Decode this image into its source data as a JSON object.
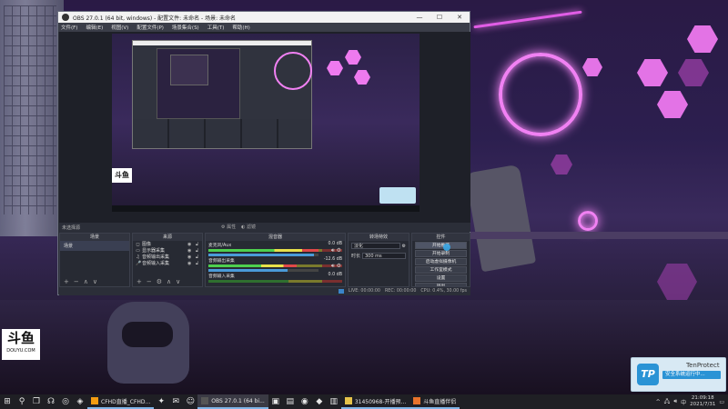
{
  "obs": {
    "title": "OBS 27.0.1 (64 bit, windows) - 配置文件: 未命名 - 场景: 未命名",
    "menu": [
      "文件(F)",
      "编辑(E)",
      "视图(V)",
      "配置文件(P)",
      "场景集合(S)",
      "工具(T)",
      "帮助(H)"
    ],
    "window_controls": {
      "minimize": "—",
      "maximize": "☐",
      "close": "✕"
    },
    "preview_toolbar": {
      "label": "未选择源",
      "properties": "属性",
      "filters": "滤镜"
    },
    "preview_watermark": "斗鱼",
    "docks": {
      "scenes": {
        "title": "场景",
        "items": [
          "场景"
        ]
      },
      "sources": {
        "title": "来源",
        "items": [
          {
            "icon": "◻",
            "name": "图像"
          },
          {
            "icon": "▭",
            "name": "显示器采集"
          },
          {
            "icon": "♫",
            "name": "音频输出采集"
          },
          {
            "icon": "🎤",
            "name": "音频输入采集"
          }
        ]
      },
      "mixer": {
        "title": "混音器",
        "channels": [
          {
            "name": "麦克风/Aux",
            "db": "0.0 dB",
            "level": 0.82,
            "volume": 0.96
          },
          {
            "name": "音频输出采集",
            "db": "-12.6 dB",
            "level": 0.66,
            "volume": 0.72
          },
          {
            "name": "音频输入采集",
            "db": "0.0 dB",
            "level": 0.0,
            "volume": 0.9
          }
        ]
      },
      "transitions": {
        "title": "转场特效",
        "type": "淡化",
        "duration_label": "时长",
        "duration": "300 ms"
      },
      "controls": {
        "title": "控件",
        "buttons": [
          "开始推流",
          "开始录制",
          "启动虚拟摄像机",
          "工作室模式",
          "设置",
          "退出"
        ]
      }
    },
    "status": {
      "live": "LIVE: 00:00:00",
      "rec": "REC: 00:00:00",
      "cpu": "CPU: 0.4%, 30.00 fps"
    }
  },
  "desktop": {
    "watermark_big": "斗鱼",
    "watermark_small": "DOUYU.COM"
  },
  "toast": {
    "app": "TenProtect",
    "logo": "TP",
    "status": "安全系统运行中..."
  },
  "taskbar": {
    "apps": [
      {
        "label": "CFHD直播_CFHD...",
        "color": "#f39c12",
        "active": false
      },
      {
        "label": "OBS 27.0.1 (64 bi...",
        "color": "#555555",
        "active": true
      },
      {
        "label": "31450968-开播预...",
        "color": "#e6c34a",
        "active": false
      },
      {
        "label": "斗鱼直播伴侣",
        "color": "#e8722b",
        "active": false
      }
    ],
    "clock": {
      "time": "21:09:18",
      "date": "2021/7/31"
    },
    "tray_caret": "^",
    "ime": "中"
  }
}
